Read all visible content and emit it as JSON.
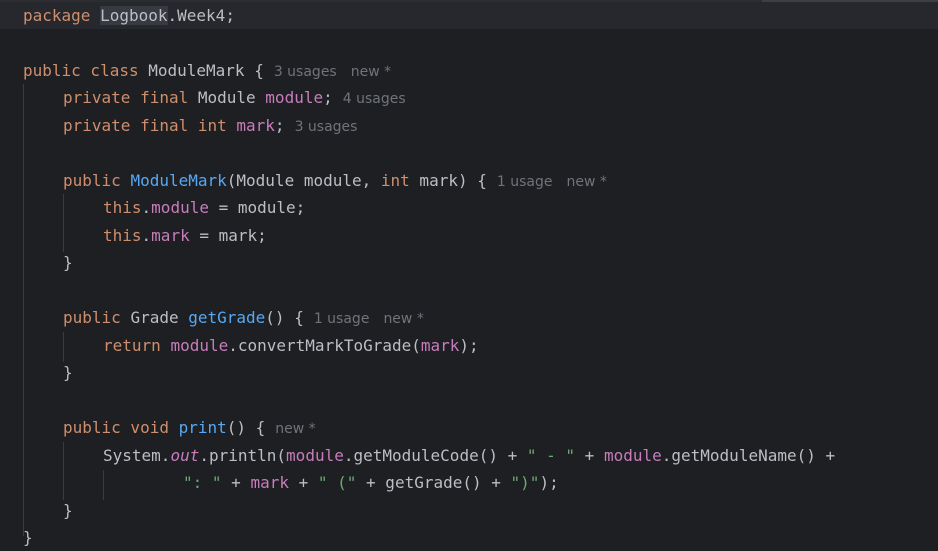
{
  "editor": {
    "package_kw": "package",
    "package_name": "Logbook",
    "package_rest": ".Week4;",
    "class_decl": {
      "kw": "public class ",
      "name": "ModuleMark {",
      "hint_usages": "3 usages",
      "hint_new": "new *"
    },
    "field_module": {
      "kw": "private final ",
      "type": "Module ",
      "name": "module",
      "semi": ";",
      "hint_usages": "4 usages"
    },
    "field_mark": {
      "kw": "private final int ",
      "name": "mark",
      "semi": ";",
      "hint_usages": "3 usages"
    },
    "constructor": {
      "kw": "public ",
      "name": "ModuleMark",
      "params_a": "(Module module, ",
      "params_kw": "int",
      "params_b": " mark) {",
      "hint_usages": "1 usage",
      "hint_new": "new *"
    },
    "assign_module": {
      "this_kw": "this",
      "dot": ".",
      "field": "module",
      "rest": " = module;"
    },
    "assign_mark": {
      "this_kw": "this",
      "dot": ".",
      "field": "mark",
      "rest": " = mark;"
    },
    "close_brace": "}",
    "get_grade": {
      "kw": "public ",
      "type": "Grade ",
      "name": "getGrade",
      "rest": "() {",
      "hint_usages": "1 usage",
      "hint_new": "new *"
    },
    "return_stmt": {
      "kw": "return ",
      "field": "module",
      "call": ".convertMarkToGrade(",
      "arg": "mark",
      "end": ");"
    },
    "print_method": {
      "kw": "public void ",
      "name": "print",
      "rest": "() {",
      "hint_new": "new *"
    },
    "println_line1": {
      "sys": "System.",
      "out": "out",
      "call": ".println(",
      "field1": "module",
      "call1": ".getModuleCode() + ",
      "str1": "\" - \"",
      "plus": " + ",
      "field2": "module",
      "call2": ".getModuleName() +"
    },
    "println_line2": {
      "str1": "\": \"",
      "plus1": " + ",
      "field": "mark",
      "plus2": " + ",
      "str2": "\" (\"",
      "call": " + getGrade() + ",
      "str3": "\")\"",
      "end": ");"
    }
  }
}
